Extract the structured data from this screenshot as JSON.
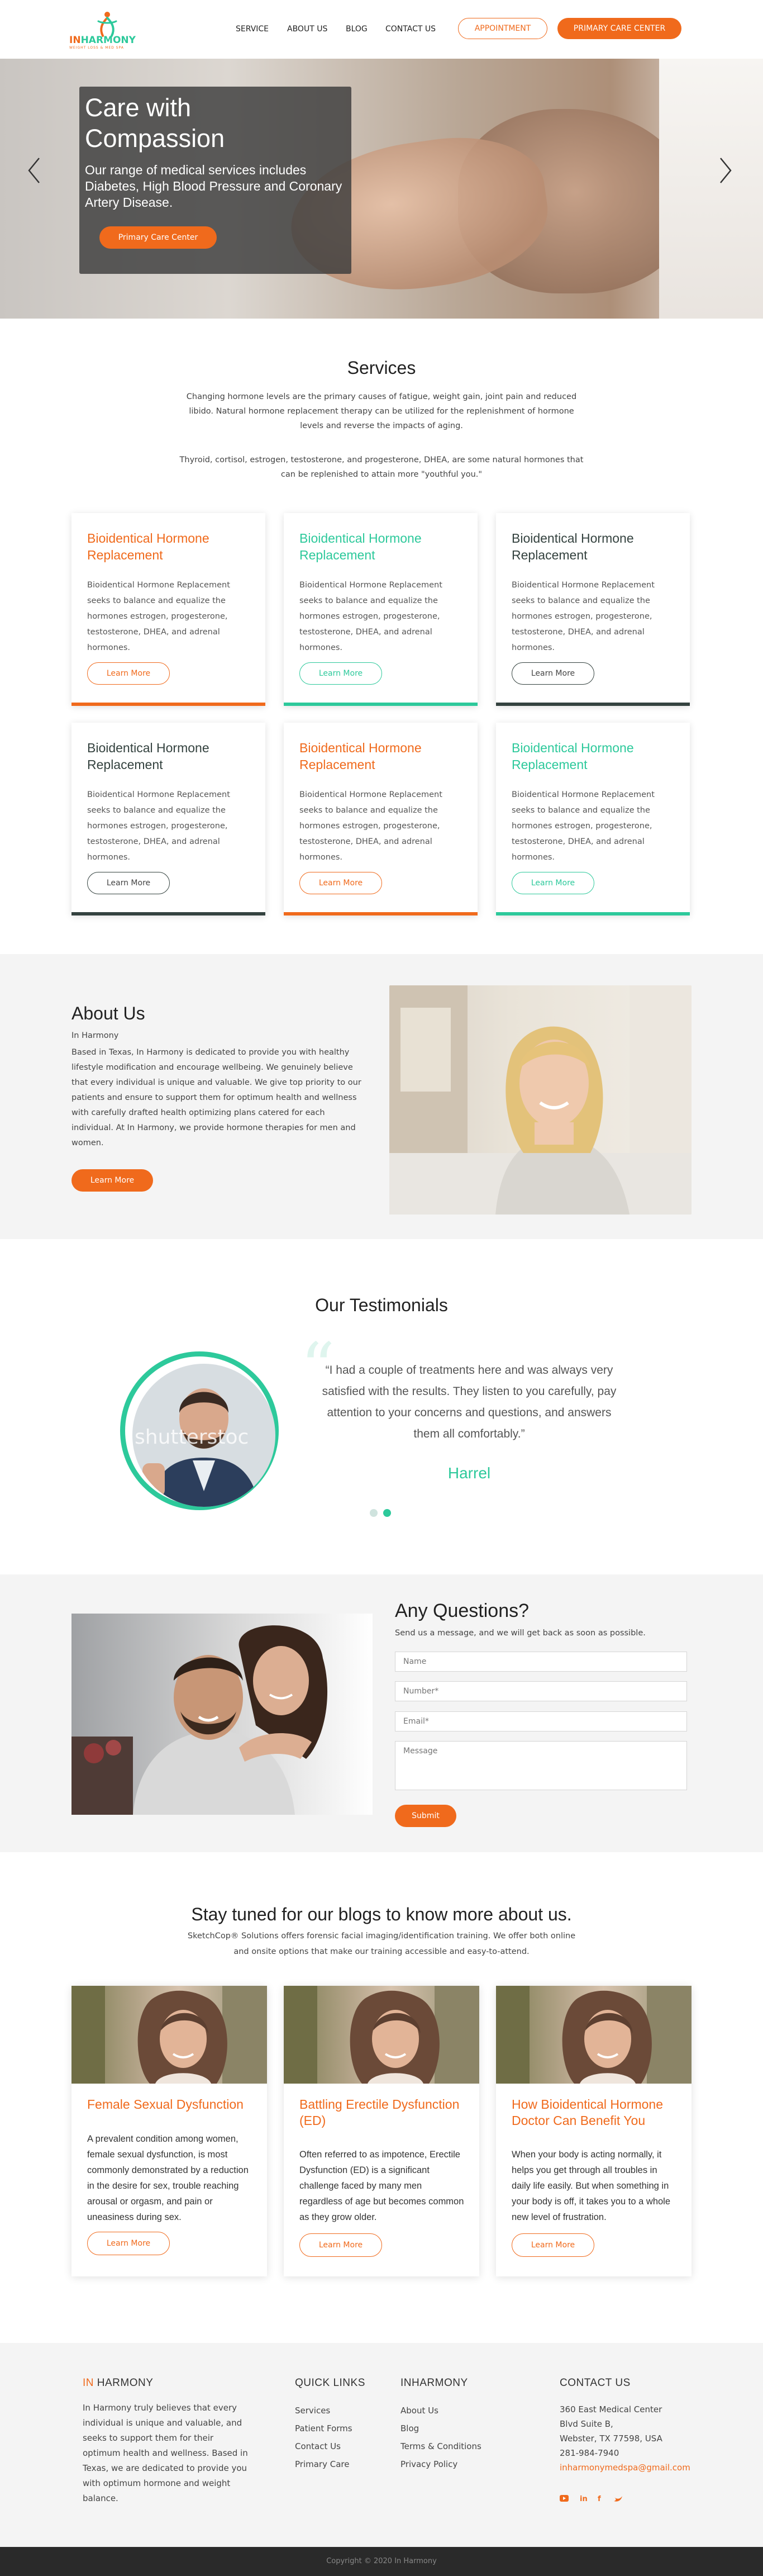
{
  "header": {
    "logo_in": "IN",
    "logo_harmony": "HARMONY",
    "logo_sub": "WEIGHT LOSS & MED SPA",
    "nav": [
      "SERVICE",
      "ABOUT US",
      "BLOG",
      "CONTACT US"
    ],
    "appointment_label": "APPOINTMENT",
    "primary_care_label": "PRIMARY CARE CENTER"
  },
  "hero": {
    "title": "Care with Compassion",
    "text": "Our range of medical services includes Diabetes, High Blood Pressure and Coronary Artery Disease.",
    "button": "Primary Care Center"
  },
  "services": {
    "title": "Services",
    "para1": "Changing hormone levels are the primary causes of fatigue, weight gain, joint pain and reduced libido. Natural hormone replacement therapy can be utilized for the replenishment of hormone levels and reverse the impacts of aging.",
    "para2": "Thyroid, cortisol, estrogen, testosterone, and progesterone, DHEA, are some natural hormones that can be replenished to attain more \"youthful you.\"",
    "cards": [
      {
        "title": "Bioidentical Hormone Replacement",
        "text": "Bioidentical Hormone Replacement seeks to balance and equalize the hormones estrogen, progesterone, testosterone, DHEA, and adrenal hormones.",
        "button": "Learn More",
        "color": "#f06a1c"
      },
      {
        "title": "Bioidentical Hormone Replacement",
        "text": "Bioidentical Hormone Replacement seeks to balance and equalize the hormones estrogen, progesterone, testosterone, DHEA, and adrenal hormones.",
        "button": "Learn More",
        "color": "#2dc99b"
      },
      {
        "title": "Bioidentical Hormone Replacement",
        "text": "Bioidentical Hormone Replacement seeks to balance and equalize the hormones estrogen, progesterone, testosterone, DHEA, and adrenal hormones.",
        "button": "Learn More",
        "color": "#34423f"
      },
      {
        "title": "Bioidentical Hormone Replacement",
        "text": "Bioidentical Hormone Replacement seeks to balance and equalize the hormones estrogen, progesterone, testosterone, DHEA, and adrenal hormones.",
        "button": "Learn More",
        "color": "#34423f"
      },
      {
        "title": "Bioidentical Hormone Replacement",
        "text": "Bioidentical Hormone Replacement seeks to balance and equalize the hormones estrogen, progesterone, testosterone, DHEA, and adrenal hormones.",
        "button": "Learn More",
        "color": "#f06a1c"
      },
      {
        "title": "Bioidentical Hormone Replacement",
        "text": "Bioidentical Hormone Replacement seeks to balance and equalize the hormones estrogen, progesterone, testosterone, DHEA, and adrenal hormones.",
        "button": "Learn More",
        "color": "#2dc99b"
      }
    ]
  },
  "about": {
    "title": "About Us",
    "subtitle": "In Harmony",
    "text": "Based in Texas, In Harmony is dedicated to provide you with healthy lifestyle modification and encourage wellbeing. We genuinely believe that every individual is unique and valuable. We give top priority to our patients and ensure to support them for optimum health and wellness with carefully drafted health optimizing plans catered for each individual. At In Harmony, we provide hormone therapies for men and women.",
    "button": "Learn More"
  },
  "testimonials": {
    "title": "Our Testimonials",
    "quote": "I had a couple of treatments here and was always very satisfied with the results. They listen to you carefully, pay attention to your concerns and questions, and answers them all comfortably.",
    "name": "Harrel",
    "watermark": "shutterstoc"
  },
  "questions": {
    "title": "Any Questions?",
    "subtitle": "Send us a message, and we will get back as soon as possible.",
    "name_placeholder": "Name",
    "number_placeholder": "Number*",
    "email_placeholder": "Email*",
    "message_placeholder": "Message",
    "submit": "Submit"
  },
  "blogs": {
    "title": "Stay tuned for our blogs to know more about us.",
    "subtitle": "SketchCop® Solutions offers forensic facial imaging/identification training. We offer both online and onsite options that make our training accessible and easy-to-attend.",
    "items": [
      {
        "title": "Female Sexual Dysfunction",
        "text": "A prevalent condition among women, female sexual dysfunction, is most commonly demonstrated by a reduction in the desire for sex, trouble reaching arousal or orgasm, and pain or uneasiness during sex.",
        "button": "Learn More"
      },
      {
        "title": "Battling Erectile Dysfunction (ED)",
        "text": "Often referred to as impotence, Erectile Dysfunction (ED) is a significant challenge faced by many men regardless of age but becomes common as they grow older.",
        "button": "Learn More"
      },
      {
        "title": "How Bioidentical Hormone Doctor Can Benefit You",
        "text": "When your body is acting normally, it helps you get through all troubles in daily life easily. But when something in your body is off, it takes you to a whole new level of frustration.",
        "button": "Learn More"
      }
    ]
  },
  "footer": {
    "brand_in": "IN",
    "brand_harmony": "HARMONY",
    "brand_text": "In Harmony truly believes that every individual is unique and valuable, and seeks to support them for their optimum health and wellness. Based in Texas, we are dedicated to provide you with optimum hormone and weight balance.",
    "quick_links_title": "QUICK LINKS",
    "quick_links": [
      "Services",
      "Patient Forms",
      "Contact Us",
      "Primary Care"
    ],
    "inharmony_title": "INHARMONY",
    "inharmony_links": [
      "About Us",
      "Blog",
      "Terms & Conditions",
      "Privacy Policy"
    ],
    "contact_title": "CONTACT US",
    "address1": "360 East Medical Center",
    "address2": "Blvd Suite B,",
    "address3": "Webster, TX 77598, USA",
    "phone": "281-984-7940",
    "email": "inharmonymedspa@gmail.com",
    "social": [
      "youtube-icon",
      "linkedin-icon",
      "facebook-icon",
      "twitter-icon"
    ],
    "copyright": "Copyright © 2020 In Harmony"
  },
  "colors": {
    "orange": "#f06a1c",
    "green": "#2dc99b",
    "dark": "#34423f"
  }
}
